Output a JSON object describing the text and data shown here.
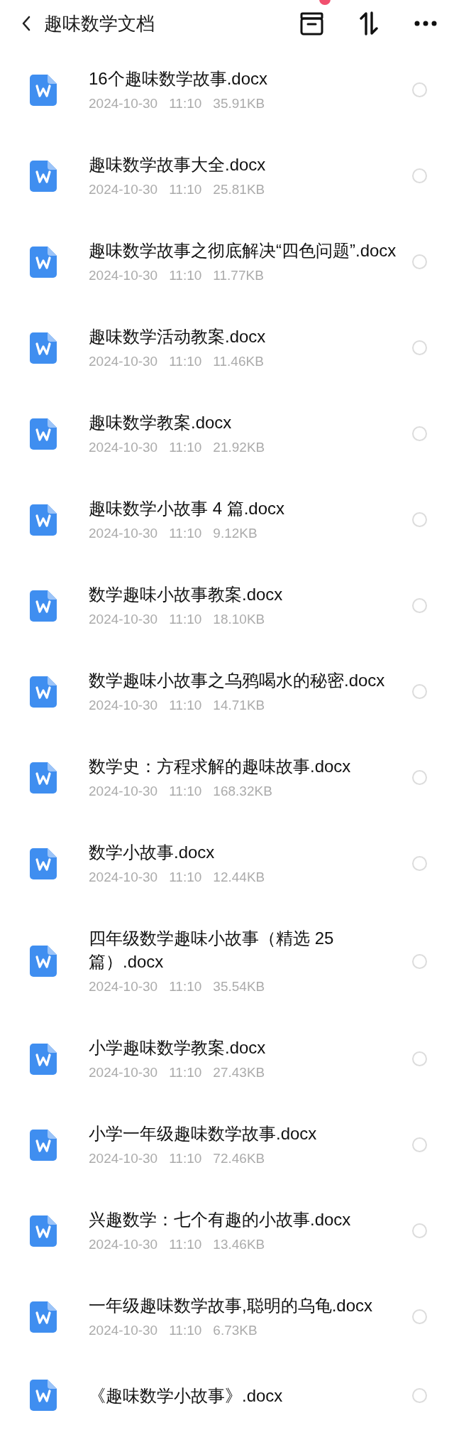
{
  "header": {
    "title": "趣味数学文档"
  },
  "files": [
    {
      "name": "16个趣味数学故事.docx",
      "date": "2024-10-30",
      "time": "11:10",
      "size": "35.91KB",
      "selected": false
    },
    {
      "name": "趣味数学故事大全.docx",
      "date": "2024-10-30",
      "time": "11:10",
      "size": "25.81KB",
      "selected": false
    },
    {
      "name": "趣味数学故事之彻底解决“四色问题”.docx",
      "date": "2024-10-30",
      "time": "11:10",
      "size": "11.77KB",
      "selected": false
    },
    {
      "name": "趣味数学活动教案.docx",
      "date": "2024-10-30",
      "time": "11:10",
      "size": "11.46KB",
      "selected": false
    },
    {
      "name": "趣味数学教案.docx",
      "date": "2024-10-30",
      "time": "11:10",
      "size": "21.92KB",
      "selected": false
    },
    {
      "name": "趣味数学小故事 4 篇.docx",
      "date": "2024-10-30",
      "time": "11:10",
      "size": "9.12KB",
      "selected": false
    },
    {
      "name": "数学趣味小故事教案.docx",
      "date": "2024-10-30",
      "time": "11:10",
      "size": "18.10KB",
      "selected": false
    },
    {
      "name": "数学趣味小故事之乌鸦喝水的秘密.docx",
      "date": "2024-10-30",
      "time": "11:10",
      "size": "14.71KB",
      "selected": false
    },
    {
      "name": "数学史：方程求解的趣味故事.docx",
      "date": "2024-10-30",
      "time": "11:10",
      "size": "168.32KB",
      "selected": false
    },
    {
      "name": "数学小故事.docx",
      "date": "2024-10-30",
      "time": "11:10",
      "size": "12.44KB",
      "selected": false
    },
    {
      "name": "四年级数学趣味小故事（精选 25 篇）.docx",
      "date": "2024-10-30",
      "time": "11:10",
      "size": "35.54KB",
      "selected": false
    },
    {
      "name": "小学趣味数学教案.docx",
      "date": "2024-10-30",
      "time": "11:10",
      "size": "27.43KB",
      "selected": false
    },
    {
      "name": "小学一年级趣味数学故事.docx",
      "date": "2024-10-30",
      "time": "11:10",
      "size": "72.46KB",
      "selected": false
    },
    {
      "name": "兴趣数学：七个有趣的小故事.docx",
      "date": "2024-10-30",
      "time": "11:10",
      "size": "13.46KB",
      "selected": false
    },
    {
      "name": "一年级趣味数学故事,聪明的乌龟.docx",
      "date": "2024-10-30",
      "time": "11:10",
      "size": "6.73KB",
      "selected": false
    },
    {
      "name": "《趣味数学小故事》.docx",
      "selected": false
    }
  ]
}
